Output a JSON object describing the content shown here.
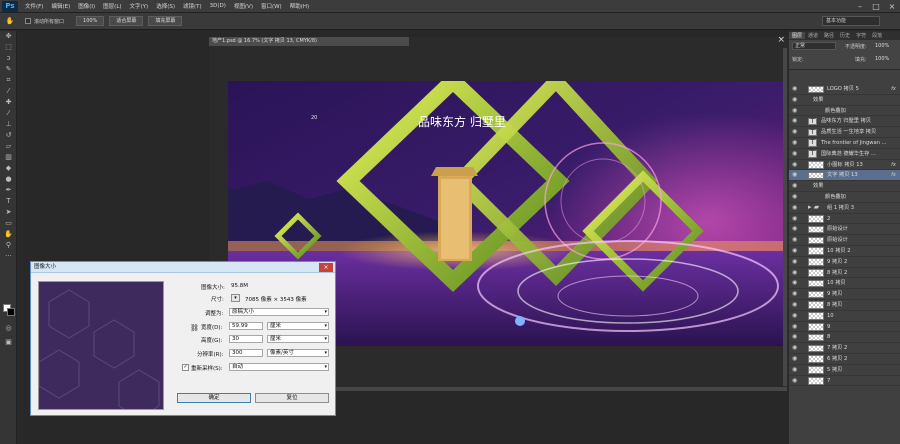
{
  "app": {
    "logo": "Ps"
  },
  "menu": [
    "文件(F)",
    "编辑(E)",
    "图像(I)",
    "图层(L)",
    "文字(Y)",
    "选择(S)",
    "滤镜(T)",
    "3D(D)",
    "视图(V)",
    "窗口(W)",
    "帮助(H)"
  ],
  "options": {
    "scroll_all_label": "滚动所有窗口",
    "zoom_100": "100%",
    "fit_screen": "适合屏幕",
    "fill_screen": "填充屏幕",
    "workspace": "基本功能"
  },
  "document": {
    "tab_title": "地产1.psd @ 16.7% (文字 拷贝 13, CMYK/8)",
    "poster_title": "品味东方 归墅里"
  },
  "dialog": {
    "title": "图像大小",
    "image_size_label": "图像大小:",
    "image_size_value": "95.8M",
    "dimensions_label": "尺寸:",
    "dimensions_value": "7085 像素 × 3543 像素",
    "fit_label": "调整为:",
    "fit_value": "原稿大小",
    "width_label": "宽度(D):",
    "width_value": "59.99",
    "width_unit": "厘米",
    "height_label": "高度(G):",
    "height_value": "30",
    "height_unit": "厘米",
    "resolution_label": "分辨率(R):",
    "resolution_value": "300",
    "resolution_unit": "像素/英寸",
    "resample_label": "重新采样(S):",
    "resample_value": "自动",
    "ok": "确定",
    "cancel": "复位"
  },
  "panel": {
    "tabs": [
      "图层",
      "通道",
      "路径",
      "历史",
      "字符",
      "段落"
    ],
    "blend_mode": "正常",
    "opacity_label": "不透明度:",
    "opacity_value": "100%",
    "lock_label": "锁定:",
    "fill_label": "填充:",
    "fill_value": "100%",
    "layers": [
      {
        "name": "LOGO 拷贝 5",
        "kind": "smart",
        "fx": "fx"
      },
      {
        "name": "效果",
        "kind": "effect"
      },
      {
        "name": "颜色叠加",
        "kind": "effect2"
      },
      {
        "name": "品味东方 归墅里 拷贝",
        "kind": "text"
      },
      {
        "name": "品质生活 一生地享 拷贝",
        "kind": "text"
      },
      {
        "name": "The frontier of Jingwan ...",
        "kind": "text"
      },
      {
        "name": "国际典范 德耀华生存 ...",
        "kind": "text"
      },
      {
        "name": "小图标 拷贝 13",
        "kind": "smart",
        "fx": "fx"
      },
      {
        "name": "文字 拷贝 13",
        "kind": "smart",
        "fx": "fx",
        "selected": true
      },
      {
        "name": "效果",
        "kind": "effect"
      },
      {
        "name": "颜色叠加",
        "kind": "effect2"
      },
      {
        "name": "组 1 拷贝 3",
        "kind": "group"
      },
      {
        "name": "2",
        "kind": "pixel"
      },
      {
        "name": "原始设计",
        "kind": "pixel"
      },
      {
        "name": "原始设计",
        "kind": "pixel"
      },
      {
        "name": "10 拷贝 2",
        "kind": "pixel"
      },
      {
        "name": "9 拷贝 2",
        "kind": "pixel"
      },
      {
        "name": "8 拷贝 2",
        "kind": "pixel"
      },
      {
        "name": "10 拷贝",
        "kind": "pixel"
      },
      {
        "name": "9 拷贝",
        "kind": "pixel"
      },
      {
        "name": "8 拷贝",
        "kind": "pixel"
      },
      {
        "name": "10",
        "kind": "pixel"
      },
      {
        "name": "9",
        "kind": "pixel"
      },
      {
        "name": "8",
        "kind": "pixel"
      },
      {
        "name": "7 拷贝 2",
        "kind": "pixel"
      },
      {
        "name": "6 拷贝 2",
        "kind": "pixel"
      },
      {
        "name": "5 拷贝",
        "kind": "pixel"
      },
      {
        "name": "7",
        "kind": "pixel"
      }
    ]
  }
}
